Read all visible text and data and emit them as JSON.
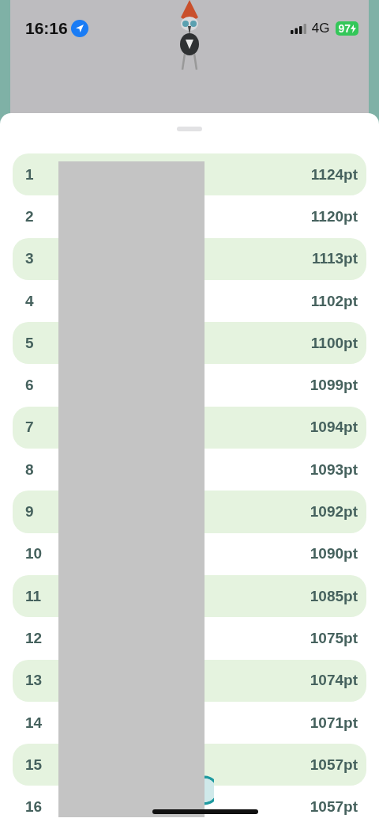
{
  "status_bar": {
    "time": "16:16",
    "network": "4G",
    "battery": "97"
  },
  "ranking": [
    {
      "rank": "1",
      "points": "1124pt"
    },
    {
      "rank": "2",
      "points": "1120pt"
    },
    {
      "rank": "3",
      "points": "1113pt"
    },
    {
      "rank": "4",
      "points": "1102pt"
    },
    {
      "rank": "5",
      "points": "1100pt"
    },
    {
      "rank": "6",
      "points": "1099pt"
    },
    {
      "rank": "7",
      "points": "1094pt"
    },
    {
      "rank": "8",
      "points": "1093pt"
    },
    {
      "rank": "9",
      "points": "1092pt"
    },
    {
      "rank": "10",
      "points": "1090pt"
    },
    {
      "rank": "11",
      "points": "1085pt"
    },
    {
      "rank": "12",
      "points": "1075pt"
    },
    {
      "rank": "13",
      "points": "1074pt"
    },
    {
      "rank": "14",
      "points": "1071pt"
    },
    {
      "rank": "15",
      "points": "1057pt"
    },
    {
      "rank": "16",
      "points": "1057pt"
    }
  ]
}
